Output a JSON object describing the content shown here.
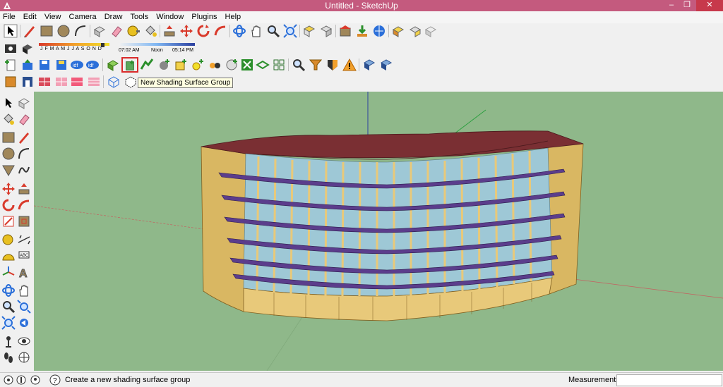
{
  "window": {
    "title": "Untitled - SketchUp",
    "minimize": "–",
    "maximize": "❐",
    "close": "✕"
  },
  "menu": [
    "File",
    "Edit",
    "View",
    "Camera",
    "Draw",
    "Tools",
    "Window",
    "Plugins",
    "Help"
  ],
  "shadows": {
    "months": "J F M A M J J A S O N D",
    "time_start": "07:02 AM",
    "time_noon": "Noon",
    "time_end": "05:14 PM"
  },
  "tooltip": "New Shading Surface Group",
  "status": {
    "hint": "Create a new shading surface group",
    "measurements_label": "Measurements",
    "measurements_value": ""
  },
  "colors": {
    "titlebar": "#c45a7e",
    "viewport": "#8fb88a",
    "roof": "#7a2f33",
    "wall": "#e8c97a",
    "glass": "#9ec8d6",
    "shade": "#5b3d8c"
  },
  "icons": {
    "row1": [
      "select-arrow-icon",
      "pencil-icon",
      "rectangle-icon",
      "circle-icon",
      "arc-icon",
      "make-component-icon",
      "eraser-icon",
      "tape-measure-icon",
      "paint-bucket-icon",
      "push-pull-icon",
      "move-icon",
      "rotate-icon",
      "follow-me-icon",
      "orbit-icon",
      "pan-icon",
      "zoom-icon",
      "zoom-extents-icon",
      "iso-view-icon",
      "top-view-icon",
      "3d-warehouse-icon",
      "get-models-icon",
      "share-model-icon",
      "extension-warehouse-icon",
      "layout-icon",
      "component-icon"
    ],
    "row3": [
      "new-file-icon",
      "open-file-icon",
      "save-icon",
      "save-as-icon",
      "idf-import-icon",
      "idf-export-icon",
      "idf-merge-icon",
      "new-space-icon",
      "new-shading-surface-group-icon",
      "new-thermal-zone-icon",
      "new-construction-icon",
      "space-diagram-icon",
      "daylight-icon",
      "lights-icon",
      "loads-icon",
      "info-icon",
      "surface-matching-icon",
      "grid-icon",
      "search-icon",
      "filter-icon",
      "render-mode-icon",
      "warning-icon",
      "inspector-icon",
      "help-icon"
    ],
    "row4": [
      "space-type-icon",
      "box-icon",
      "render-surface-icon",
      "render-boundary-icon",
      "render-construction-icon",
      "render-thermal-icon",
      "wireframe-icon",
      "hidden-line-icon"
    ],
    "left": [
      "select-icon",
      "component-icon",
      "paint-icon",
      "eraser-icon",
      "rectangle-icon",
      "line-icon",
      "circle-icon",
      "arc-icon",
      "polygon-icon",
      "freehand-icon",
      "move-icon",
      "push-pull-icon",
      "rotate-icon",
      "follow-me-icon",
      "scale-icon",
      "offset-icon",
      "tape-measure-icon",
      "dimension-icon",
      "protractor-icon",
      "text-icon",
      "axes-icon",
      "3d-text-icon",
      "orbit-icon",
      "pan-icon",
      "zoom-icon",
      "zoom-window-icon",
      "zoom-extents-icon",
      "previous-view-icon",
      "position-camera-icon",
      "look-around-icon",
      "walk-icon",
      "section-plane-icon"
    ]
  }
}
